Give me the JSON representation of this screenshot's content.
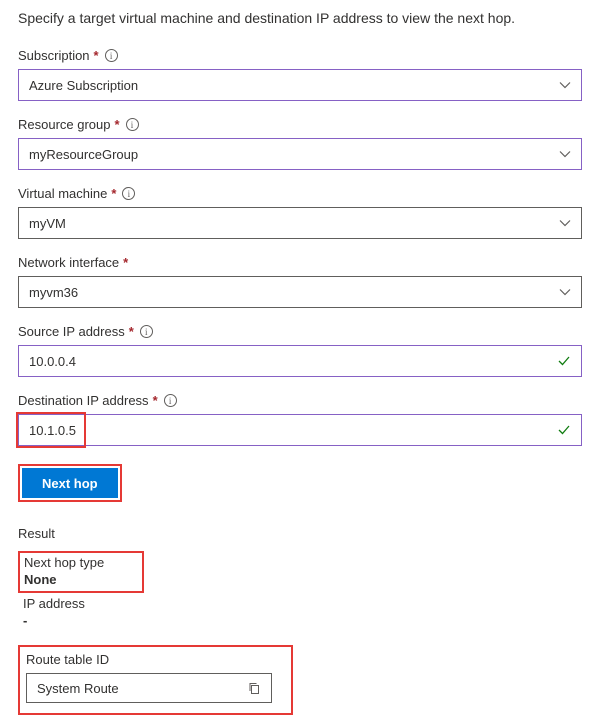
{
  "instruction": "Specify a target virtual machine and destination IP address to view the next hop.",
  "fields": {
    "subscription": {
      "label": "Subscription",
      "value": "Azure Subscription"
    },
    "resourceGroup": {
      "label": "Resource group",
      "value": "myResourceGroup"
    },
    "virtualMachine": {
      "label": "Virtual machine",
      "value": "myVM"
    },
    "networkInterface": {
      "label": "Network interface",
      "value": "myvm36"
    },
    "sourceIp": {
      "label": "Source IP address",
      "value": "10.0.0.4"
    },
    "destIp": {
      "label": "Destination IP address",
      "value": "10.1.0.5"
    }
  },
  "buttons": {
    "nextHop": "Next hop"
  },
  "result": {
    "heading": "Result",
    "nextHopTypeLabel": "Next hop type",
    "nextHopTypeValue": "None",
    "ipAddressLabel": "IP address",
    "ipAddressValue": "-",
    "routeTableLabel": "Route table ID",
    "routeTableValue": "System Route"
  }
}
